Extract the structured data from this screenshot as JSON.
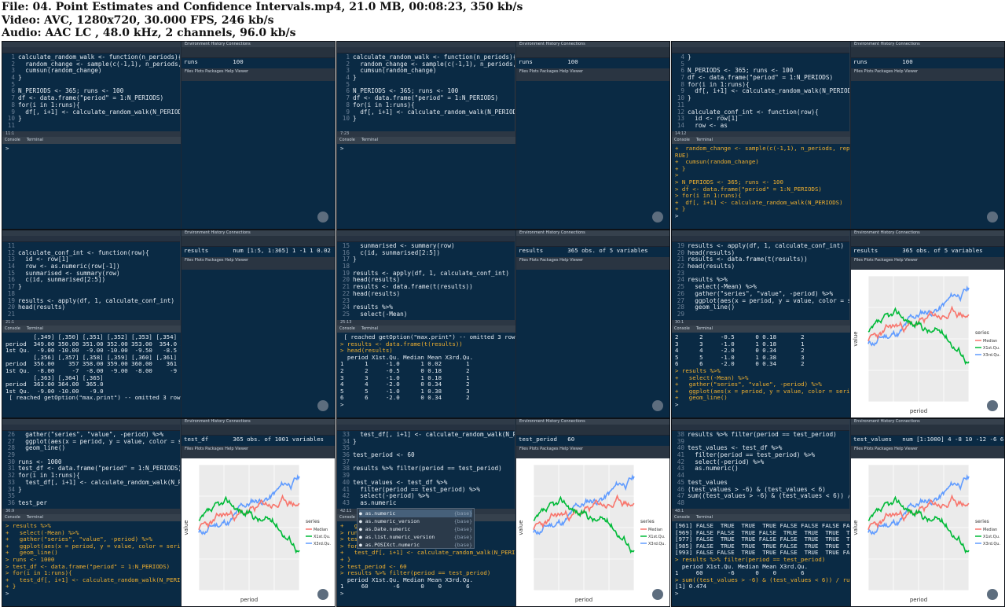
{
  "header": {
    "line1": "File: 04. Point Estimates and Confidence Intervals.mp4, 21.0 MB, 00:08:23, 350 kb/s",
    "line2": "Video: AVC, 1280x720, 30.000 FPS, 246 kb/s",
    "line3": "Audio: AAC LC , 48.0 kHz, 2 channels, 96.0 kb/s"
  },
  "ui": {
    "console_tab": "Console",
    "terminal_tab": "Terminal",
    "env_tabs": "Environment   History   Connections",
    "plot_tabs": "Files   Plots   Packages   Help   Viewer"
  },
  "legend": {
    "title": "series",
    "items": [
      "Median",
      "X1st.Qu.",
      "X3rd.Qu."
    ]
  },
  "axis": {
    "xlabel": "period",
    "ylabel": "value"
  },
  "autocomplete": [
    {
      "name": "as.numeric",
      "pkg": "{base}"
    },
    {
      "name": "as.numeric_version",
      "pkg": "{base}"
    },
    {
      "name": "as.Date.numeric",
      "pkg": "{base}"
    },
    {
      "name": "as.list.numeric_version",
      "pkg": "{base}"
    },
    {
      "name": "as.POSIXct.numeric",
      "pkg": "{base}"
    }
  ],
  "tiles": [
    {
      "status": "11:1",
      "env": [
        "runs          100"
      ],
      "plot": false,
      "code": [
        [
          "1",
          "calculate_random_walk <- function(n_periods){"
        ],
        [
          "2",
          "  random_change <- sample(c(-1,1), n_periods, replace ="
        ],
        [
          "3",
          "  cumsun(random_change)"
        ],
        [
          "4",
          "}"
        ],
        [
          "5",
          ""
        ],
        [
          "6",
          "N_PERIODS <- 365; runs <- 100"
        ],
        [
          "7",
          "df <- data.frame(\"period\" = 1:N_PERIODS)"
        ],
        [
          "8",
          "for(i in 1:runs){"
        ],
        [
          "9",
          "  df[, i+1] <- calculate_random_walk(N_PERIODS)"
        ],
        [
          "10",
          "}"
        ],
        [
          "11",
          ""
        ]
      ],
      "console": [
        [
          ">",
          ""
        ]
      ]
    },
    {
      "status": "7:23",
      "env": [
        "runs          100"
      ],
      "plot": false,
      "code": [
        [
          "1",
          "calculate_random_walk <- function(n_periods){"
        ],
        [
          "2",
          "  random_change <- sample(c(-1,1), n_periods, replace ="
        ],
        [
          "3",
          "  cumsun(random_change)"
        ],
        [
          "4",
          "}"
        ],
        [
          "5",
          ""
        ],
        [
          "6",
          "N_PERIODS <- 365; runs <- 100"
        ],
        [
          "7",
          "df <- data.frame(\"period\" = 1:N_PERIODS)"
        ],
        [
          "8",
          "for(i in 1:runs){"
        ],
        [
          "9",
          "  df[, i+1] <- calculate_random_walk(N_PERIODS)"
        ],
        [
          "10",
          "}"
        ]
      ],
      "console": [
        [
          ">",
          ""
        ]
      ]
    },
    {
      "status": "14:12",
      "env": [
        "runs          100"
      ],
      "plot": false,
      "code": [
        [
          "4",
          "}"
        ],
        [
          "5",
          ""
        ],
        [
          "6",
          "N_PERIODS <- 365; runs <- 100"
        ],
        [
          "7",
          "df <- data.frame(\"period\" = 1:N_PERIODS)"
        ],
        [
          "8",
          "for(i in 1:runs){"
        ],
        [
          "9",
          "  df[, i+1] <- calculate_random_walk(N_PERIODS)"
        ],
        [
          "10",
          "}"
        ],
        [
          "11",
          ""
        ],
        [
          "12",
          "calculate_conf_int <- function(row){"
        ],
        [
          "13",
          "  id <- row[1]"
        ],
        [
          "14",
          "  row <- as"
        ]
      ],
      "console": [
        [
          "in",
          "+  random_change <- sample(c(-1,1), n_periods, replace = T"
        ],
        [
          "in",
          "RUE)"
        ],
        [
          "in",
          "+  cumsun(random_change)"
        ],
        [
          "in",
          "+ }"
        ],
        [
          "in",
          ">"
        ],
        [
          "in",
          "> N_PERIODS <- 365; runs <- 100"
        ],
        [
          "in",
          "> df <- data.frame(\"period\" = 1:N_PERIODS)"
        ],
        [
          "in",
          "> for(i in 1:runs){"
        ],
        [
          "in",
          "+  df[, i+1] <- calculate_random_walk(N_PERIODS)"
        ],
        [
          "in",
          "+ }"
        ],
        [
          "out",
          ">"
        ]
      ]
    },
    {
      "status": "21:1",
      "env": [
        "results       num [1:5, 1:365] 1 -1 1 0.02 1 2..."
      ],
      "plot": false,
      "code": [
        [
          "11",
          ""
        ],
        [
          "12",
          "calculate_conf_int <- function(row){"
        ],
        [
          "13",
          "  id <- row[1]"
        ],
        [
          "14",
          "  row <- as.numeric(row[-1])"
        ],
        [
          "15",
          "  sunmarised <- summary(row)"
        ],
        [
          "16",
          "  c(id, sunmarised[2:5])"
        ],
        [
          "17",
          "}"
        ],
        [
          "18",
          ""
        ],
        [
          "19",
          "results <- apply(df, 1, calculate_conf_int)"
        ],
        [
          "20",
          "head(results)"
        ],
        [
          "21",
          ""
        ]
      ],
      "console": [
        [
          "out",
          "        [,349] [,350] [,351] [,352] [,353] [,354] [,355]"
        ],
        [
          "out",
          "period  349.00 350.00 351.00 352.00 353.00  354.0 355.00"
        ],
        [
          "out",
          "1st Qu.  -9.00 -10.00  -9.00 -10.00  -9.50   -8.5  -9.00"
        ],
        [
          "out",
          "        [,356] [,357] [,358] [,359] [,360] [,361] [,362]"
        ],
        [
          "out",
          "period  356.00    357 358.00 359.00 360.00    361 362.00"
        ],
        [
          "out",
          "1st Qu.  -8.00     -7  -8.00  -9.00  -8.00     -9  -8.50"
        ],
        [
          "out",
          "        [,363] [,364] [,365]"
        ],
        [
          "out",
          "period  363.00 364.00  365.0"
        ],
        [
          "out",
          "1st Qu.  -9.00 -10.00   -9.0"
        ],
        [
          "out",
          " [ reached getOption(\"max.print\") -- omitted 3 rows ]"
        ]
      ]
    },
    {
      "status": "25:13",
      "env": [
        "results       365 obs. of 5 variables"
      ],
      "plot": false,
      "code": [
        [
          "15",
          "  sunmarised <- summary(row)"
        ],
        [
          "16",
          "  c(id, sunmarised[2:5])"
        ],
        [
          "17",
          "}"
        ],
        [
          "18",
          ""
        ],
        [
          "19",
          "results <- apply(df, 1, calculate_conf_int)"
        ],
        [
          "20",
          "head(results)"
        ],
        [
          "21",
          "results <- data.frame(t(results))"
        ],
        [
          "22",
          "head(results)"
        ],
        [
          "23",
          ""
        ],
        [
          "24",
          "results %>%"
        ],
        [
          "25",
          "  select(-Mean)"
        ]
      ],
      "console": [
        [
          "out",
          " [ reached getOption(\"max.print\") -- omitted 3 rows ]"
        ],
        [
          "in",
          "> results <- data.frame(t(results))"
        ],
        [
          "in",
          "> head(results)"
        ],
        [
          "out",
          "  period X1st.Qu. Median Mean X3rd.Qu."
        ],
        [
          "out",
          "1      1     -1.0      1 0.02       1"
        ],
        [
          "out",
          "2      2     -0.5      0 0.18       2"
        ],
        [
          "out",
          "3      3     -1.0      1 0.18       1"
        ],
        [
          "out",
          "4      4     -2.0      0 0.34       2"
        ],
        [
          "out",
          "5      5     -1.0      1 0.38       3"
        ],
        [
          "out",
          "6      6     -2.0      0 0.34       2"
        ],
        [
          "out",
          ">"
        ]
      ]
    },
    {
      "status": "30:1",
      "env": [
        "results       365 obs. of 5 variables"
      ],
      "plot": true,
      "code": [
        [
          "19",
          "results <- apply(df, 1, calculate_conf_int)"
        ],
        [
          "20",
          "head(results)"
        ],
        [
          "21",
          "results <- data.frame(t(results))"
        ],
        [
          "22",
          "head(results)"
        ],
        [
          "23",
          ""
        ],
        [
          "24",
          "results %>%"
        ],
        [
          "25",
          "  select(-Mean) %>%"
        ],
        [
          "26",
          "  gather(\"series\", \"value\", -period) %>%"
        ],
        [
          "27",
          "  ggplot(aes(x = period, y = value, color = series)) +"
        ],
        [
          "28",
          "  geom_line()"
        ],
        [
          "29",
          ""
        ]
      ],
      "console": [
        [
          "out",
          "2      2     -0.5      0 0.18       2"
        ],
        [
          "out",
          "3      3     -1.0      1 0.18       1"
        ],
        [
          "out",
          "4      4     -2.0      0 0.34       2"
        ],
        [
          "out",
          "5      5     -1.0      1 0.38       3"
        ],
        [
          "out",
          "6      6     -2.0      0 0.34       2"
        ],
        [
          "in",
          "> results %>%"
        ],
        [
          "in",
          "+   select(-Mean) %>%"
        ],
        [
          "in",
          "+   gather(\"series\", \"value\", -period) %>%"
        ],
        [
          "in",
          "+   ggplot(aes(x = period, y = value, color = series)) +"
        ],
        [
          "in",
          "+   geom_line()"
        ],
        [
          "out",
          ">"
        ]
      ]
    },
    {
      "status": "36:9",
      "env": [
        "test_df       365 obs. of 1001 variables"
      ],
      "plot": true,
      "code": [
        [
          "26",
          "  gather(\"series\", \"value\", -period) %>%"
        ],
        [
          "27",
          "  ggplot(aes(x = period, y = value, color = series)) +"
        ],
        [
          "28",
          "  geom_line()"
        ],
        [
          "29",
          ""
        ],
        [
          "30",
          "runs <- 1000"
        ],
        [
          "31",
          "test_df <- data.frame(\"period\" = 1:N_PERIODS)"
        ],
        [
          "32",
          "for(i in 1:runs){"
        ],
        [
          "33",
          "  test_df[, i+1] <- calculate_random_walk(N_PERIODS)"
        ],
        [
          "34",
          "}"
        ],
        [
          "35",
          ""
        ],
        [
          "36",
          "test_per"
        ]
      ],
      "console": [
        [
          "in",
          "> results %>%"
        ],
        [
          "in",
          "+   select(-Mean) %>%"
        ],
        [
          "in",
          "+   gather(\"series\", \"value\", -period) %>%"
        ],
        [
          "in",
          "+   ggplot(aes(x = period, y = value, color = series)) +"
        ],
        [
          "in",
          "+   geom_line()"
        ],
        [
          "in",
          "> runs <- 1000"
        ],
        [
          "in",
          "> test_df <- data.frame(\"period\" = 1:N_PERIODS)"
        ],
        [
          "in",
          "> for(i in 1:runs){"
        ],
        [
          "in",
          "+   test_df[, i+1] <- calculate_random_walk(N_PERIODS)"
        ],
        [
          "in",
          "+ }"
        ],
        [
          "out",
          ">"
        ]
      ]
    },
    {
      "status": "42:11",
      "env": [
        "test_period   60"
      ],
      "plot": true,
      "autocomplete": true,
      "code": [
        [
          "33",
          "  test_df[, i+1] <- calculate_random_walk(N_PERIODS)"
        ],
        [
          "34",
          "}"
        ],
        [
          "35",
          ""
        ],
        [
          "36",
          "test_period <- 60"
        ],
        [
          "37",
          ""
        ],
        [
          "38",
          "results %>% filter(period == test_period)"
        ],
        [
          "39",
          ""
        ],
        [
          "40",
          "test_values <- test_df %>%"
        ],
        [
          "41",
          "  filter(period == test_period) %>%"
        ],
        [
          "42",
          "  select(-period) %>%"
        ],
        [
          "43",
          "  as.numeric"
        ]
      ],
      "console": [
        [
          "in",
          "+   ge"
        ],
        [
          "in",
          "> runs"
        ],
        [
          "in",
          "> test"
        ],
        [
          "in",
          "> for(i in 1:runs){"
        ],
        [
          "in",
          "+   test_df[, i+1] <- calculate_random_walk(N_PERIODS)"
        ],
        [
          "in",
          "+ }"
        ],
        [
          "in",
          "> test_period <- 60"
        ],
        [
          "in",
          "> results %>% filter(period == test_period)"
        ],
        [
          "out",
          "  period X1st.Qu. Median Mean X3rd.Qu."
        ],
        [
          "out",
          "1     60       -6      0    0       6"
        ],
        [
          "out",
          ">"
        ]
      ]
    },
    {
      "status": "48:1",
      "env": [
        "test_values   num [1:1000] 4 -8 10 -12 -6 6 20 2..."
      ],
      "plot": true,
      "code": [
        [
          "38",
          "results %>% filter(period == test_period)"
        ],
        [
          "39",
          ""
        ],
        [
          "40",
          "test_values <- test_df %>%"
        ],
        [
          "41",
          "  filter(period == test_period) %>%"
        ],
        [
          "42",
          "  select(-period) %>%"
        ],
        [
          "43",
          "  as.numeric()"
        ],
        [
          "44",
          ""
        ],
        [
          "45",
          "test_values"
        ],
        [
          "46",
          "(test_values > -6) & (test_values < 6)"
        ],
        [
          "47",
          "sum((test_values > -6) & (test_values < 6)) / runs"
        ],
        [
          "48",
          ""
        ]
      ],
      "console": [
        [
          "out",
          "[961] FALSE  TRUE  TRUE  TRUE FALSE FALSE FALSE FALSE"
        ],
        [
          "out",
          "[969] FALSE FALSE  TRUE FALSE  TRUE  TRUE  TRUE  TRUE"
        ],
        [
          "out",
          "[977] FALSE  TRUE  TRUE FALSE FALSE  TRUE  TRUE  TRUE"
        ],
        [
          "out",
          "[985] FALSE  TRUE  TRUE  TRUE FALSE  TRUE  TRUE  TRUE"
        ],
        [
          "out",
          "[993] FALSE FALSE  TRUE  TRUE FALSE  TRUE  TRUE FALSE"
        ],
        [
          "in",
          "> results %>% filter(period == test_period)"
        ],
        [
          "out",
          "  period X1st.Qu. Median Mean X3rd.Qu."
        ],
        [
          "out",
          "1     60       -6      0    0       6"
        ],
        [
          "in",
          "> sum((test_values > -6) & (test_values < 6)) / runs"
        ],
        [
          "out",
          "[1] 0.474"
        ],
        [
          "out",
          ">"
        ]
      ]
    }
  ]
}
